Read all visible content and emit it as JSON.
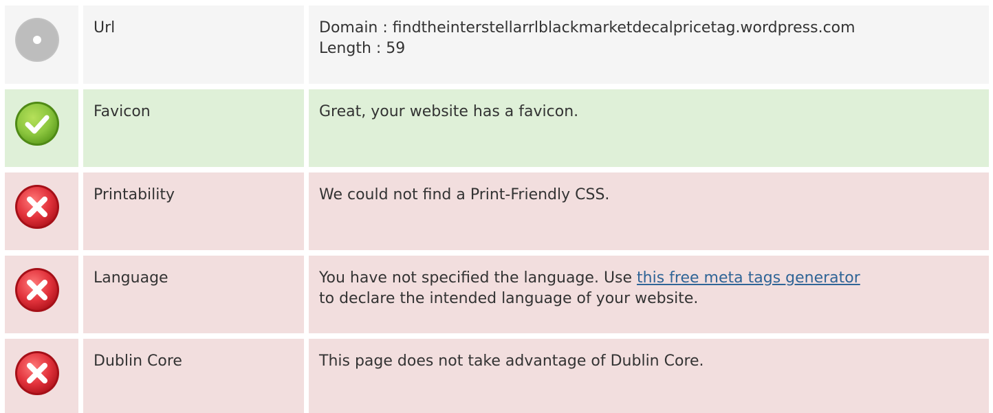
{
  "rows": [
    {
      "status": "neutral",
      "icon": "neutral-dot-icon",
      "label": "Url",
      "lines": [
        "Domain : findtheinterstellarrlblackmarketdecalpricetag.wordpress.com",
        "Length : 59"
      ]
    },
    {
      "status": "success",
      "icon": "check-circle-icon",
      "label": "Favicon",
      "text": "Great, your website has a favicon."
    },
    {
      "status": "fail",
      "icon": "error-circle-icon",
      "label": "Printability",
      "text": "We could not find a Print-Friendly CSS."
    },
    {
      "status": "fail",
      "icon": "error-circle-icon",
      "label": "Language",
      "text_before": "You have not specified the language. Use ",
      "link_text": "this free meta tags generator",
      "text_after": "to declare the intended language of your website."
    },
    {
      "status": "fail",
      "icon": "error-circle-icon",
      "label": "Dublin Core",
      "text": "This page does not take advantage of Dublin Core."
    }
  ],
  "colors": {
    "neutral_bg": "#f5f5f5",
    "success_bg": "#dff0d8",
    "fail_bg": "#f2dede",
    "link": "#2f6496",
    "success_icon": "#7bbf2a",
    "fail_icon": "#e0303a",
    "neutral_icon": "#c0c0c0"
  }
}
